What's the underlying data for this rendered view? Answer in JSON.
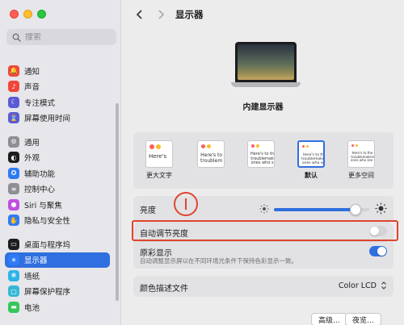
{
  "sidebar": {
    "search_placeholder": "搜索",
    "items": [
      {
        "label": "通知",
        "icon": "bell-icon",
        "color": "#f0473b"
      },
      {
        "label": "声音",
        "icon": "speaker-icon",
        "color": "#f0473b"
      },
      {
        "label": "专注模式",
        "icon": "moon-icon",
        "color": "#5b5bd6"
      },
      {
        "label": "屏幕使用时间",
        "icon": "hourglass-icon",
        "color": "#5b5bd6"
      },
      {
        "label": "通用",
        "icon": "gear-icon",
        "color": "#8e8e93"
      },
      {
        "label": "外观",
        "icon": "appearance-icon",
        "color": "#1d1d1f"
      },
      {
        "label": "辅助功能",
        "icon": "accessibility-icon",
        "color": "#2f7bf5"
      },
      {
        "label": "控制中心",
        "icon": "control-center-icon",
        "color": "#8e8e93"
      },
      {
        "label": "Siri 与聚焦",
        "icon": "siri-icon",
        "color": "#c050e0"
      },
      {
        "label": "隐私与安全性",
        "icon": "hand-icon",
        "color": "#2f7bf5"
      },
      {
        "label": "桌面与程序坞",
        "icon": "dock-icon",
        "color": "#1d1d1f"
      },
      {
        "label": "显示器",
        "icon": "sun-icon",
        "color": "#2f7bf5",
        "active": true
      },
      {
        "label": "墙纸",
        "icon": "wallpaper-icon",
        "color": "#2fb4e8"
      },
      {
        "label": "屏幕保护程序",
        "icon": "screensaver-icon",
        "color": "#35b8d6"
      },
      {
        "label": "电池",
        "icon": "battery-icon",
        "color": "#34c759"
      }
    ]
  },
  "header": {
    "title": "显示器",
    "back_icon": "chevron-left-icon",
    "forward_icon": "chevron-right-icon"
  },
  "display": {
    "name": "内建显示器"
  },
  "resolution": {
    "options": [
      {
        "label": "更大文字",
        "sample": "Here's",
        "selected": false
      },
      {
        "label": "",
        "sample": "Here's to\ntroublem",
        "selected": false
      },
      {
        "label": "",
        "sample": "Here's to th\ntroublemak\nones who s",
        "selected": false
      },
      {
        "label": "默认",
        "sample": "Here's to the\ntroublemakers\nones who see",
        "selected": true
      },
      {
        "label": "更多空间",
        "sample": "Here's to the cr\ntroublemakers, t\nones who see thi",
        "selected": false
      }
    ]
  },
  "brightness": {
    "label": "亮度",
    "level": 0.86
  },
  "auto_brightness": {
    "label": "自动调节亮度",
    "enabled": false
  },
  "true_tone": {
    "label": "原彩显示",
    "description": "自动调整显示屏以在不同环境光条件下保持色彩显示一致。",
    "enabled": true
  },
  "color_profile": {
    "label": "颜色描述文件",
    "value": "Color LCD"
  },
  "buttons": {
    "advanced": "高级...",
    "night_shift": "夜览..."
  },
  "colors": {
    "accent": "#2f6fdf",
    "annotation": "#e0442d"
  }
}
